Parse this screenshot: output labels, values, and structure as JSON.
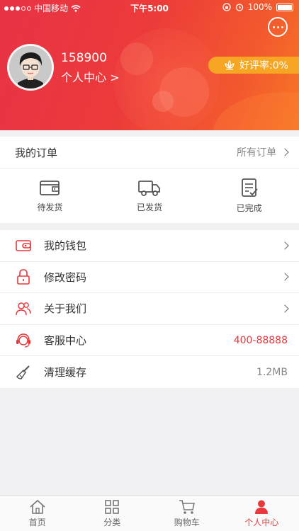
{
  "status_bar": {
    "carrier": "中国移动",
    "time": "下午5:00",
    "battery": "100%"
  },
  "profile": {
    "username": "158900",
    "personal_center_link": "个人中心 >",
    "rating": "好评率:0%"
  },
  "orders": {
    "title": "我的订单",
    "all_orders": "所有订单",
    "items": [
      {
        "label": "待发货",
        "icon": "wallet-icon"
      },
      {
        "label": "已发货",
        "icon": "truck-icon"
      },
      {
        "label": "已完成",
        "icon": "checklist-icon"
      }
    ]
  },
  "menu": [
    {
      "label": "我的钱包",
      "icon": "wallet-icon",
      "value": ""
    },
    {
      "label": "修改密码",
      "icon": "lock-icon",
      "value": ""
    },
    {
      "label": "关于我们",
      "icon": "people-icon",
      "value": ""
    },
    {
      "label": "客服中心",
      "icon": "headset-icon",
      "value": "400-88888"
    },
    {
      "label": "清理缓存",
      "icon": "broom-icon",
      "value": "1.2MB"
    }
  ],
  "tabbar": [
    {
      "label": "首页",
      "icon": "home-icon"
    },
    {
      "label": "分类",
      "icon": "grid-icon"
    },
    {
      "label": "购物车",
      "icon": "cart-icon"
    },
    {
      "label": "个人中心",
      "icon": "person-icon"
    }
  ],
  "colors": {
    "accent": "#e8383d",
    "rating_badge": "#f6a623"
  }
}
